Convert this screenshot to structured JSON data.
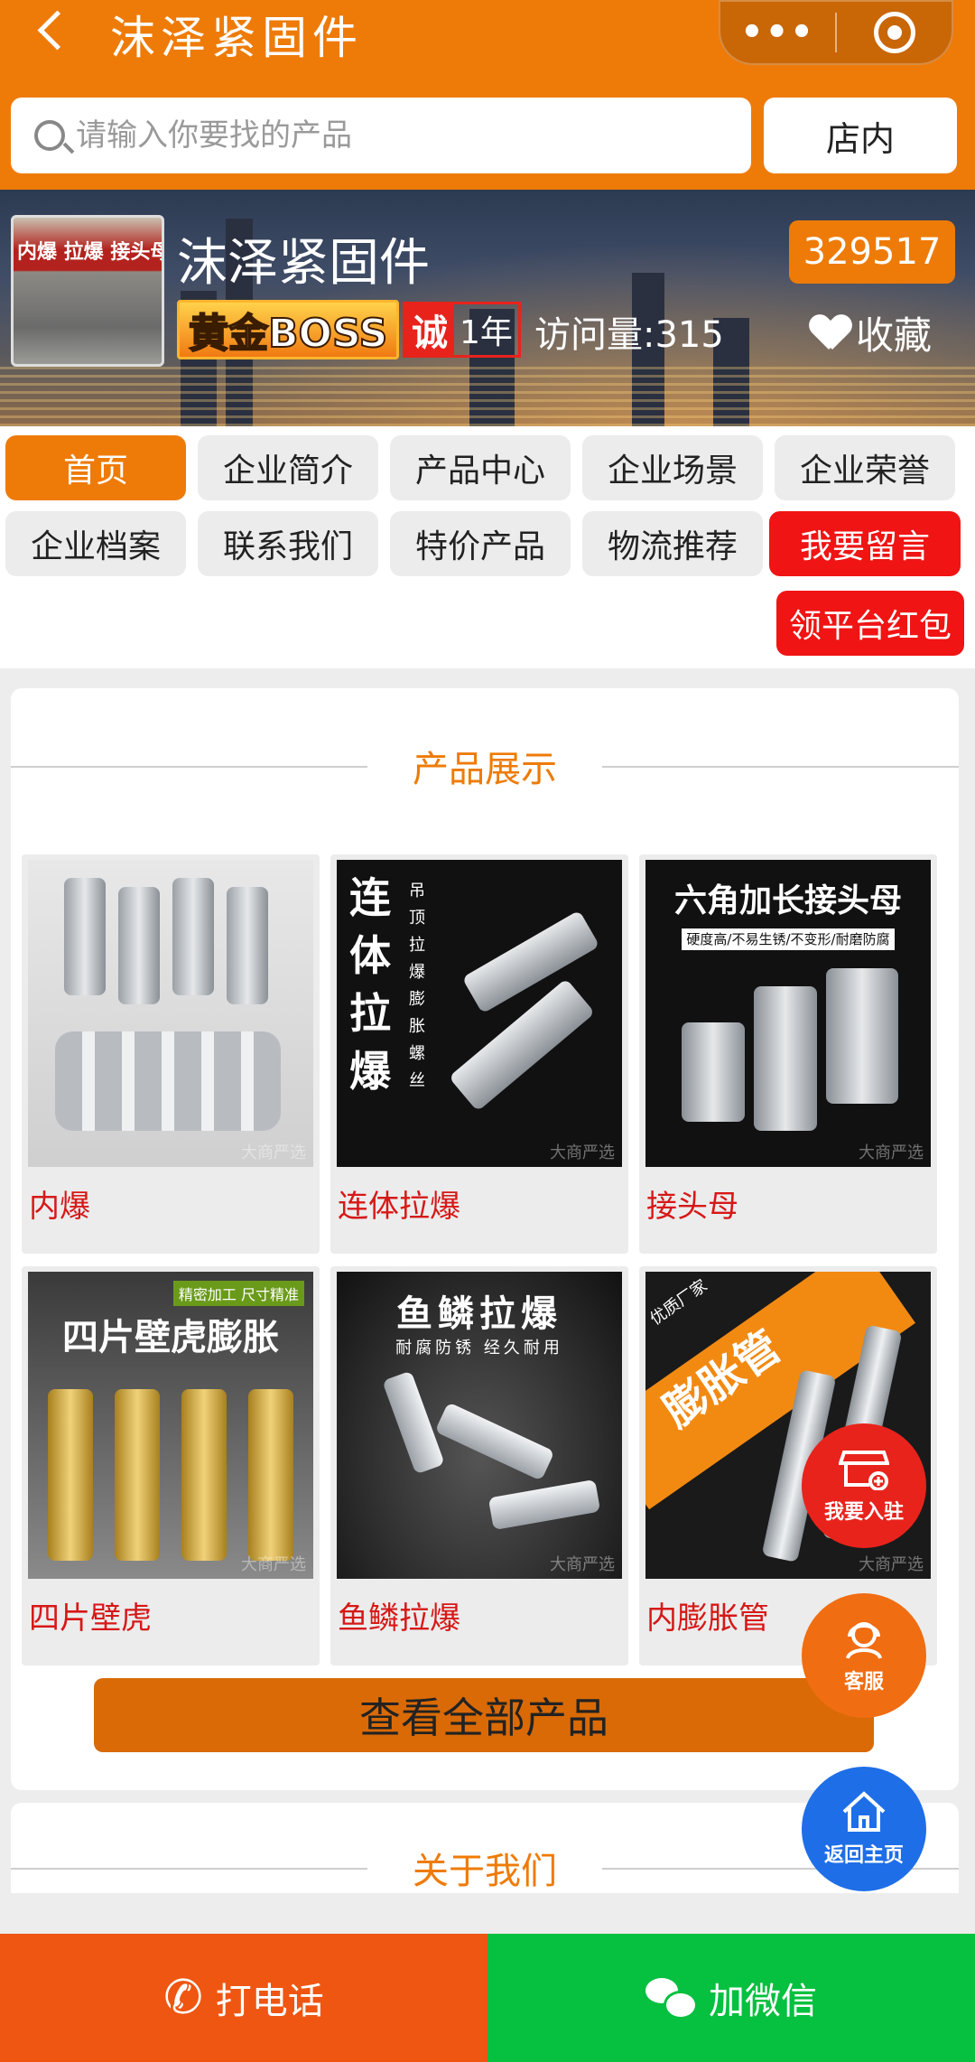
{
  "header": {
    "title": "沫泽紧固件",
    "more_label": "•••"
  },
  "search": {
    "placeholder": "请输入你要找的产品",
    "scope_label": "店内"
  },
  "shop": {
    "name": "沫泽紧固件",
    "id": "329517",
    "photo_sign": "内爆 拉爆 接头母",
    "membership": "黄金BOSS",
    "cheng_mark": "诚",
    "years": "1年",
    "visits": "访问量:315",
    "favorite_label": "收藏"
  },
  "nav": {
    "items": [
      "首页",
      "企业简介",
      "产品中心",
      "企业场景",
      "企业荣誉",
      "企业档案",
      "联系我们",
      "特价产品",
      "物流推荐",
      "我要留言"
    ],
    "active_index": 0,
    "redpacket": "领平台红包"
  },
  "products": {
    "section_title": "产品展示",
    "items": [
      {
        "name": "内爆",
        "image_text": ""
      },
      {
        "name": "连体拉爆",
        "image_text": "连体拉爆",
        "image_subtext": "吊顶拉爆膨胀螺丝"
      },
      {
        "name": "接头母",
        "image_text": "六角加长接头母",
        "image_subtext": "硬度高/不易生锈/不变形/耐磨防腐"
      },
      {
        "name": "四片壁虎",
        "image_text": "四片壁虎膨胀",
        "image_subtext": "精密加工 尺寸精准"
      },
      {
        "name": "鱼鳞拉爆",
        "image_text": "鱼鳞拉爆",
        "image_subtext": "耐腐防锈 经久耐用"
      },
      {
        "name": "内膨胀管",
        "image_text": "膨胀管",
        "image_subtext": "优质厂家"
      }
    ],
    "watermark": "大商严选",
    "view_all": "查看全部产品"
  },
  "about": {
    "section_title": "关于我们"
  },
  "floating": {
    "join": "我要入驻",
    "service": "客服",
    "home": "返回主页"
  },
  "bottom_bar": {
    "call": "打电话",
    "wechat": "加微信"
  },
  "colors": {
    "brand_orange": "#ee7b08",
    "red": "#f01414",
    "call_orange": "#ef5612",
    "wechat_green": "#06c03f",
    "home_blue": "#1e6ee8"
  }
}
